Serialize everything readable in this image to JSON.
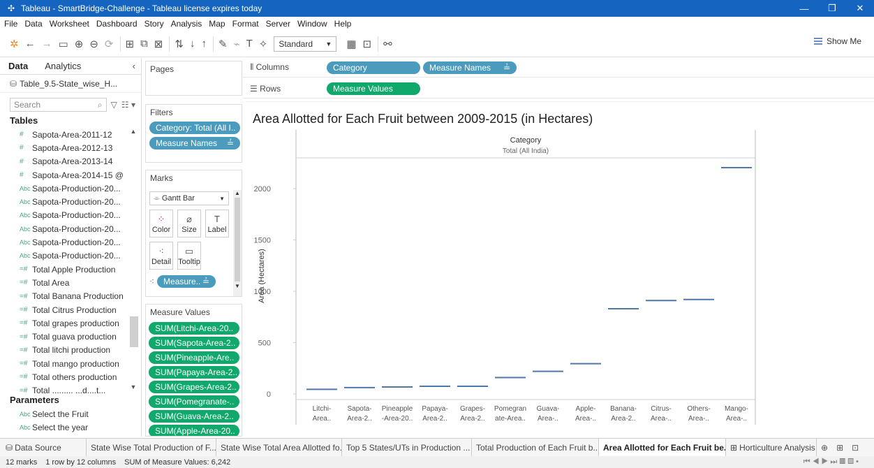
{
  "window": {
    "title": "Tableau - SmartBridge-Challenge - Tableau license expires today"
  },
  "menu": [
    "File",
    "Data",
    "Worksheet",
    "Dashboard",
    "Story",
    "Analysis",
    "Map",
    "Format",
    "Server",
    "Window",
    "Help"
  ],
  "toolbar": {
    "fit": "Standard",
    "show_me": "Show Me"
  },
  "datapane": {
    "tabs": [
      "Data",
      "Analytics"
    ],
    "datasource": "Table_9.5-State_wise_H...",
    "search_placeholder": "Search",
    "tables_header": "Tables",
    "fields": [
      {
        "type": "#",
        "label": "Sapota-Area-2011-12"
      },
      {
        "type": "#",
        "label": "Sapota-Area-2012-13"
      },
      {
        "type": "#",
        "label": "Sapota-Area-2013-14"
      },
      {
        "type": "#",
        "label": "Sapota-Area-2014-15 @"
      },
      {
        "type": "Abc",
        "label": "Sapota-Production-20..."
      },
      {
        "type": "Abc",
        "label": "Sapota-Production-20..."
      },
      {
        "type": "Abc",
        "label": "Sapota-Production-20..."
      },
      {
        "type": "Abc",
        "label": "Sapota-Production-20..."
      },
      {
        "type": "Abc",
        "label": "Sapota-Production-20..."
      },
      {
        "type": "Abc",
        "label": "Sapota-Production-20..."
      },
      {
        "type": "=#",
        "label": "Total Apple Production"
      },
      {
        "type": "=#",
        "label": "Total Area"
      },
      {
        "type": "=#",
        "label": "Total Banana Production"
      },
      {
        "type": "=#",
        "label": "Total Citrus Production"
      },
      {
        "type": "=#",
        "label": "Total grapes production"
      },
      {
        "type": "=#",
        "label": "Total guava production"
      },
      {
        "type": "=#",
        "label": "Total litchi production"
      },
      {
        "type": "=#",
        "label": "Total mango production"
      },
      {
        "type": "=#",
        "label": "Total others production"
      },
      {
        "type": "=#",
        "label": "Total ......... ...d....t..."
      }
    ],
    "parameters_header": "Parameters",
    "parameters": [
      {
        "type": "Abc",
        "label": "Select the Fruit"
      },
      {
        "type": "Abc",
        "label": "Select the year"
      }
    ]
  },
  "shelves": {
    "pages": "Pages",
    "filters_header": "Filters",
    "filters": [
      "Category: Total (All I..",
      "Measure Names"
    ],
    "marks_header": "Marks",
    "mark_type": "Gantt Bar",
    "mark_buttons": [
      "Color",
      "Size",
      "Label",
      "Detail",
      "Tooltip"
    ],
    "marks_pill": "Measure..",
    "measure_values_header": "Measure Values",
    "measure_values": [
      "SUM(Litchi-Area-20..",
      "SUM(Sapota-Area-2..",
      "SUM(Pineapple-Are..",
      "SUM(Papaya-Area-2..",
      "SUM(Grapes-Area-2..",
      "SUM(Pomegranate-..",
      "SUM(Guava-Area-2..",
      "SUM(Apple-Area-20.."
    ]
  },
  "columns": {
    "label": "Columns",
    "pills": [
      "Category",
      "Measure Names"
    ]
  },
  "rows": {
    "label": "Rows",
    "pills": [
      "Measure Values"
    ]
  },
  "view": {
    "title": "Area Allotted for Each Fruit between 2009-2015 (in Hectares)"
  },
  "colors": {
    "mark": "#4e79a7",
    "pill_blue": "#4a9bbd",
    "pill_green": "#10a96b",
    "titlebar": "#1565c0"
  },
  "chart_data": {
    "type": "gantt",
    "title": "Area Allotted for Each Fruit between 2009-2015 (in Hectares)",
    "header_title": "Category",
    "header_value": "Total (All India)",
    "ylabel": "Area (Hectares)",
    "ylim": [
      0,
      2300
    ],
    "yticks": [
      0,
      500,
      1000,
      1500,
      2000
    ],
    "categories": [
      [
        "Litchi-",
        "Area.."
      ],
      [
        "Sapota-",
        "Area-2.."
      ],
      [
        "Pineapple",
        "-Area-20.."
      ],
      [
        "Papaya-",
        "Area-2.."
      ],
      [
        "Grapes-",
        "Area-2.."
      ],
      [
        "Pomegran",
        "ate-Area.."
      ],
      [
        "Guava-",
        "Area-.."
      ],
      [
        "Apple-",
        "Area-.."
      ],
      [
        "Banana-",
        "Area-2.."
      ],
      [
        "Citrus-",
        "Area-.."
      ],
      [
        "Others-",
        "Area-.."
      ],
      [
        "Mango-",
        "Area-.."
      ]
    ],
    "values": [
      45,
      62,
      68,
      75,
      75,
      160,
      220,
      295,
      830,
      910,
      920,
      2205
    ],
    "grid": false
  },
  "bottom_tabs": [
    "Data Source",
    "State Wise Total Production of F...",
    "State Wise Total Area Allotted fo...",
    "Top 5 States/UTs in Production ...",
    "Total Production of Each Fruit b...",
    "Area Allotted for Each Fruit be...",
    "Horticulture Analysis"
  ],
  "status": {
    "marks": "12 marks",
    "dims": "1 row by 12 columns",
    "sum": "SUM of Measure Values: 6,242"
  }
}
